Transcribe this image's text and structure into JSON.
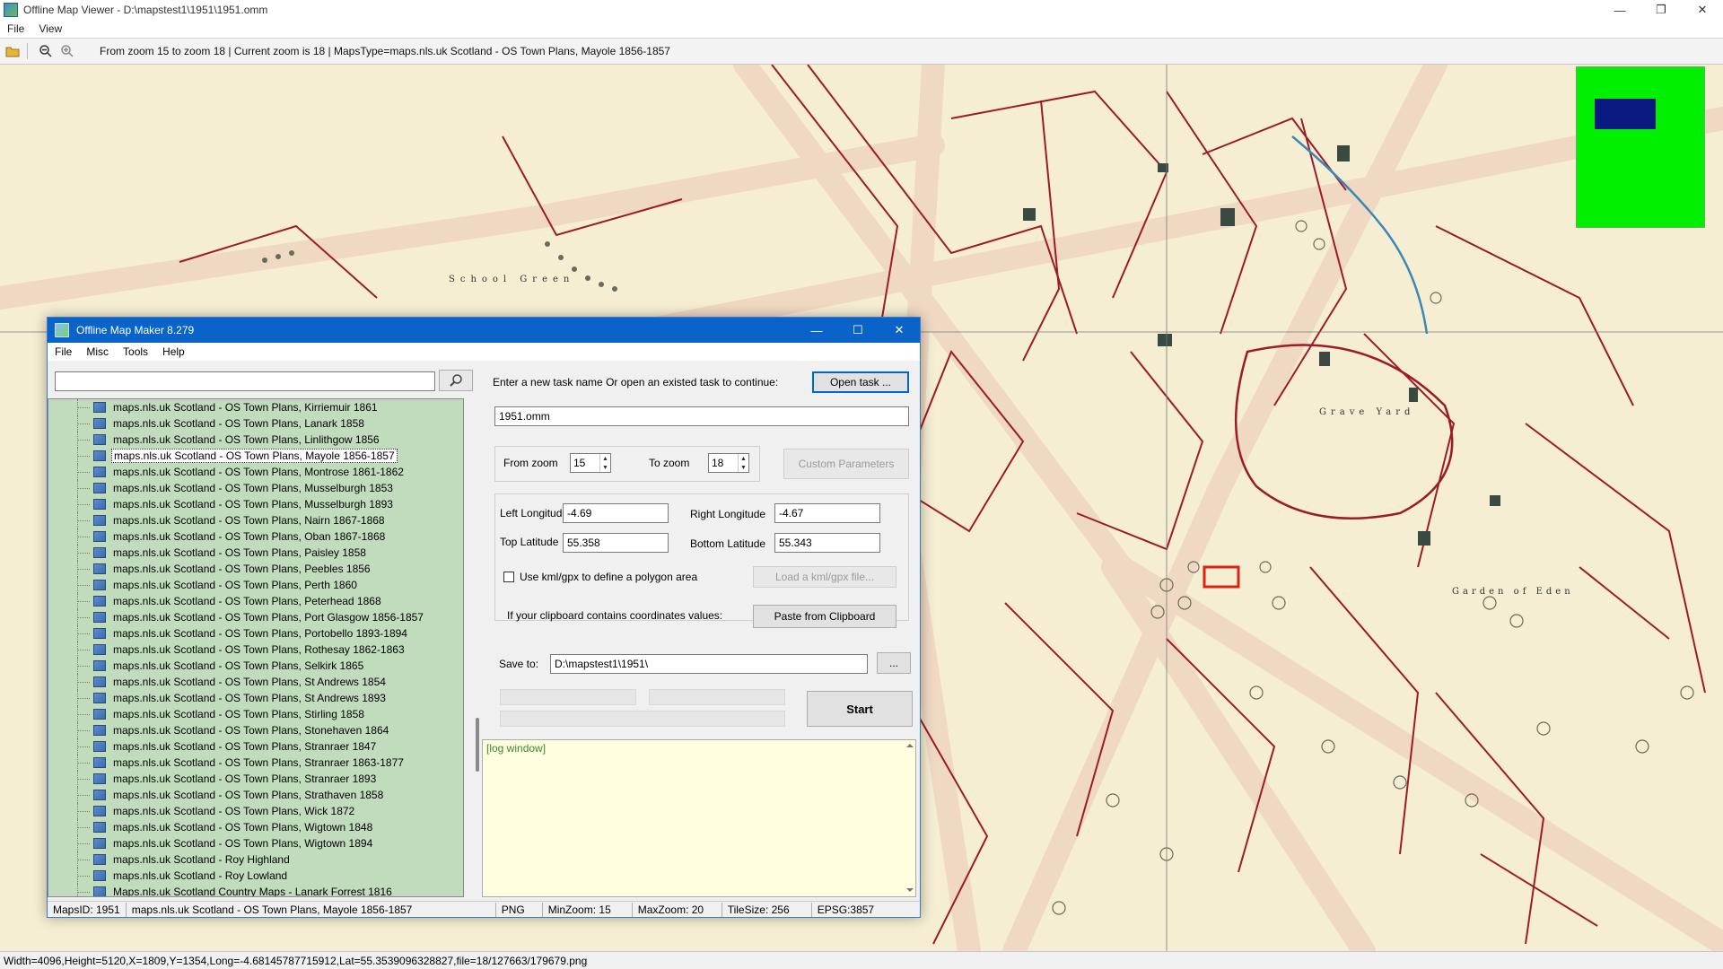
{
  "viewer": {
    "title": "Offline Map Viewer - D:\\mapstest1\\1951\\1951.omm",
    "menu": [
      "File",
      "View"
    ],
    "toolbar_info": "From zoom 15 to zoom 18   |   Current zoom is 18 |    MapsType=maps.nls.uk Scotland - OS Town Plans, Mayole 1856-1857",
    "status": "Width=4096,Height=5120,X=1809,Y=1354,Long=-4.68145787715912,Lat=55.3539096328827,file=18/127663/179679.png",
    "map_labels": [
      "School Green",
      "Grave Yard",
      "Garden of Eden"
    ]
  },
  "dialog": {
    "title": "Offline Map Maker 8.279",
    "menu": [
      "File",
      "Misc",
      "Tools",
      "Help"
    ],
    "search_placeholder": "",
    "tree_items": [
      "maps.nls.uk Scotland - OS Town Plans, Kirriemuir 1861",
      "maps.nls.uk Scotland - OS Town Plans, Lanark 1858",
      "maps.nls.uk Scotland - OS Town Plans, Linlithgow 1856",
      "maps.nls.uk Scotland - OS Town Plans, Mayole 1856-1857",
      "maps.nls.uk Scotland - OS Town Plans, Montrose 1861-1862",
      "maps.nls.uk Scotland - OS Town Plans, Musselburgh 1853",
      "maps.nls.uk Scotland - OS Town Plans, Musselburgh 1893",
      "maps.nls.uk Scotland - OS Town Plans, Nairn 1867-1868",
      "maps.nls.uk Scotland - OS Town Plans, Oban 1867-1868",
      "maps.nls.uk Scotland - OS Town Plans, Paisley 1858",
      "maps.nls.uk Scotland - OS Town Plans, Peebles 1856",
      "maps.nls.uk Scotland - OS Town Plans, Perth 1860",
      "maps.nls.uk Scotland - OS Town Plans, Peterhead 1868",
      "maps.nls.uk Scotland - OS Town Plans, Port Glasgow 1856-1857",
      "maps.nls.uk Scotland - OS Town Plans, Portobello 1893-1894",
      "maps.nls.uk Scotland - OS Town Plans, Rothesay 1862-1863",
      "maps.nls.uk Scotland - OS Town Plans, Selkirk 1865",
      "maps.nls.uk Scotland - OS Town Plans, St Andrews 1854",
      "maps.nls.uk Scotland - OS Town Plans, St Andrews 1893",
      "maps.nls.uk Scotland - OS Town Plans, Stirling 1858",
      "maps.nls.uk Scotland - OS Town Plans, Stonehaven 1864",
      "maps.nls.uk Scotland - OS Town Plans, Stranraer 1847",
      "maps.nls.uk Scotland - OS Town Plans, Stranraer 1863-1877",
      "maps.nls.uk Scotland - OS Town Plans, Stranraer 1893",
      "maps.nls.uk Scotland - OS Town Plans, Strathaven 1858",
      "maps.nls.uk Scotland - OS Town Plans, Wick 1872",
      "maps.nls.uk Scotland - OS Town Plans, Wigtown 1848",
      "maps.nls.uk Scotland - OS Town Plans, Wigtown 1894",
      "maps.nls.uk Scotland - Roy Highland",
      "maps.nls.uk Scotland - Roy Lowland",
      "Maps.nls.uk Scotland Country Maps - Lanark Forrest 1816"
    ],
    "selected_index": 3,
    "task_prompt": "Enter a new task name Or open an existed task to continue:",
    "open_task_label": "Open task ...",
    "task_name": "1951.omm",
    "from_zoom_label": "From zoom",
    "from_zoom_value": "15",
    "to_zoom_label": "To zoom",
    "to_zoom_value": "18",
    "custom_params_label": "Custom Parameters",
    "left_lon_label": "Left Longitude",
    "left_lon_value": "-4.69",
    "right_lon_label": "Right Longitude",
    "right_lon_value": "-4.67",
    "top_lat_label": "Top Latitude",
    "top_lat_value": "55.358",
    "bottom_lat_label": "Bottom Latitude",
    "bottom_lat_value": "55.343",
    "kml_check_label": "Use kml/gpx to define a polygon area",
    "load_kml_label": "Load a kml/gpx file...",
    "clipboard_prompt": "If your clipboard contains coordinates values:",
    "paste_label": "Paste from Clipboard",
    "save_to_label": "Save to:",
    "save_to_value": "D:\\mapstest1\\1951\\",
    "browse_label": "...",
    "start_label": "Start",
    "log_text": "[log window]",
    "status": {
      "maps_id": "MapsID: 1951",
      "maps_name": "maps.nls.uk Scotland - OS Town Plans, Mayole 1856-1857",
      "format": "PNG",
      "min_zoom": "MinZoom: 15",
      "max_zoom": "MaxZoom: 20",
      "tile_size": "TileSize: 256",
      "epsg": "EPSG:3857"
    }
  },
  "colors": {
    "map_bg": "#f6eed2",
    "map_line": "#9b1b2b",
    "tree_bg": "#c1dcbd",
    "dialog_title": "#0a63c9",
    "minimap": "#00f000",
    "minimap_viewport": "#0a1a80",
    "log_bg": "#ffffe0"
  }
}
